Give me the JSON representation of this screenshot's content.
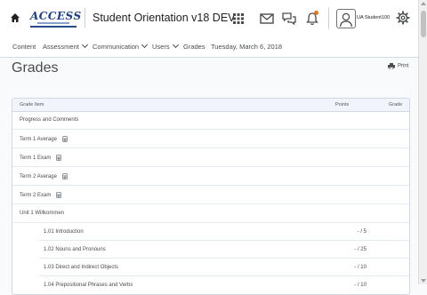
{
  "header": {
    "logo_text": "ACCESS",
    "org_title": "Student Orientation v18 DEV",
    "user_name": "UA Student100",
    "icons": [
      "home-icon",
      "waffle-icon",
      "mail-icon",
      "chat-icon",
      "bell-icon",
      "user-avatar-icon",
      "gear-icon"
    ],
    "badge_color": "#e87511"
  },
  "nav": {
    "items": [
      {
        "label": "Content"
      },
      {
        "label": "Assessment"
      },
      {
        "label": "Communication"
      },
      {
        "label": "Users"
      },
      {
        "label": "Grades"
      },
      {
        "label": "Tuesday, March 6, 2018"
      }
    ]
  },
  "page": {
    "title": "Grades",
    "print_label": "Print"
  },
  "table": {
    "columns": {
      "item": "Grade Item",
      "points": "Points",
      "grade": "Grade"
    },
    "rows": [
      {
        "name": "Progress and Comments",
        "points": "",
        "calc": false
      },
      {
        "name": "Term 1 Average",
        "points": "",
        "calc": true
      },
      {
        "name": "Term 1 Exam",
        "points": "",
        "calc": true
      },
      {
        "name": "Term 2 Average",
        "points": "",
        "calc": true
      },
      {
        "name": "Term 2 Exam",
        "points": "",
        "calc": true
      },
      {
        "name": "Unit 1 Willkommen",
        "points": "",
        "calc": false
      },
      {
        "name": "1.01 Introduction",
        "points": "- / 5",
        "calc": false
      },
      {
        "name": "1.02 Nouns and Pronouns",
        "points": "- / 25",
        "calc": false
      },
      {
        "name": "1.03 Direct and Indirect Objects",
        "points": "- / 10",
        "calc": false
      },
      {
        "name": "1.04 Prepositional Phrases and Verbs",
        "points": "- / 10",
        "calc": false
      }
    ]
  }
}
